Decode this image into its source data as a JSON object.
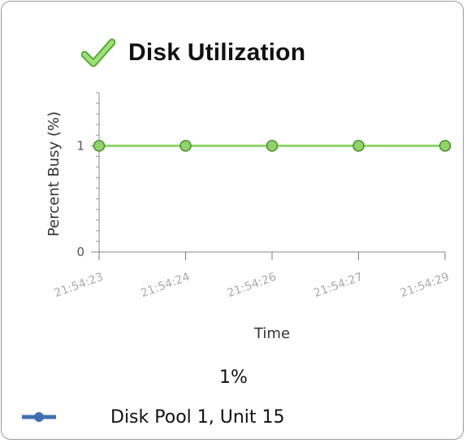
{
  "panel": {
    "title": "Disk Utilization",
    "status_icon": "check-icon",
    "current_value": "1%",
    "accent_color": "#8fd36a",
    "legend": {
      "icon": "line-series-marker-icon",
      "label": "Disk Pool 1, Unit 15",
      "color": "#3f6fb0"
    }
  },
  "chart_data": {
    "type": "line",
    "title": "Disk Utilization",
    "xlabel": "Time",
    "ylabel": "Percent Busy (%)",
    "x": [
      "21:54:23",
      "21:54:24",
      "21:54:26",
      "21:54:27",
      "21:54:29"
    ],
    "series": [
      {
        "name": "Disk Pool 1, Unit 15",
        "values": [
          1,
          1,
          1,
          1,
          1
        ],
        "color": "#8fd36a"
      }
    ],
    "y_ticks": [
      "0",
      "1"
    ],
    "ylim": [
      0,
      1.5
    ],
    "grid": false,
    "legend_position": "bottom-left"
  }
}
